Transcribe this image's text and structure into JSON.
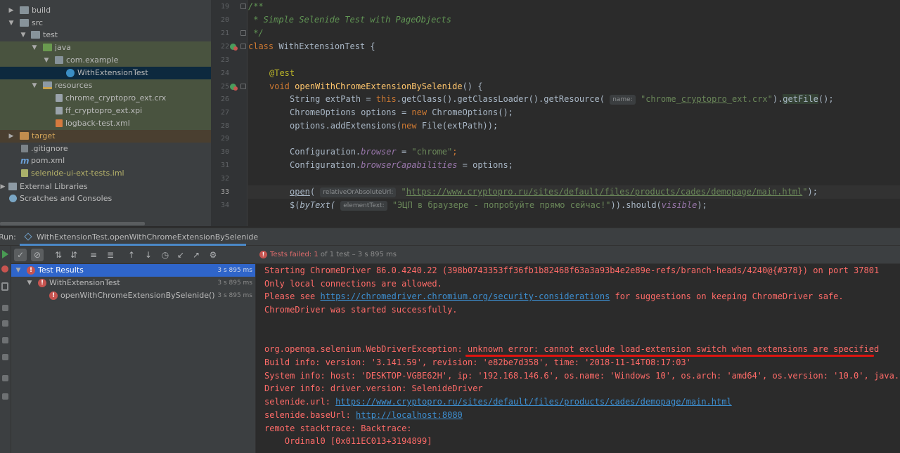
{
  "project_tree": [
    {
      "label": "build",
      "icon": "folder-icon",
      "expanded": false
    },
    {
      "label": "src",
      "icon": "folder-icon",
      "expanded": true
    },
    {
      "label": "test",
      "icon": "folder-icon",
      "expanded": true
    },
    {
      "label": "java",
      "icon": "test-source-folder-icon",
      "expanded": true
    },
    {
      "label": "com.example",
      "icon": "package-icon",
      "expanded": true
    },
    {
      "label": "WithExtensionTest",
      "icon": "class-icon"
    },
    {
      "label": "resources",
      "icon": "resources-folder-icon",
      "expanded": true
    },
    {
      "label": "chrome_cryptopro_ext.crx",
      "icon": "file-icon"
    },
    {
      "label": "ff_cryptopro_ext.xpi",
      "icon": "file-icon"
    },
    {
      "label": "logback-test.xml",
      "icon": "xml-file-icon"
    },
    {
      "label": "target",
      "icon": "excluded-folder-icon",
      "expanded": false
    },
    {
      "label": ".gitignore",
      "icon": "gitignore-file-icon"
    },
    {
      "label": "pom.xml",
      "icon": "maven-file-icon"
    },
    {
      "label": "selenide-ui-ext-tests.iml",
      "icon": "module-file-icon"
    },
    {
      "label": "External Libraries",
      "icon": "library-icon",
      "expanded": false
    },
    {
      "label": "Scratches and Consoles",
      "icon": "scratches-icon",
      "expanded": false
    }
  ],
  "editor": {
    "line_numbers": [
      "19",
      "20",
      "21",
      "22",
      "23",
      "24",
      "25",
      "26",
      "27",
      "28",
      "29",
      "30",
      "31",
      "32",
      "33",
      "34"
    ],
    "current_line": "33",
    "tokens": {
      "c1": "/**",
      "c2": " * Simple Selenide Test with PageObjects",
      "c3": " */",
      "class_kw": "class",
      "class_name": " WithExtensionTest {",
      "annotation": "@Test",
      "void_kw": "void",
      "method_name": "openWithChromeExtensionBySelenide",
      "method_rest": "() {",
      "l26_a": "String extPath = ",
      "l26_this": "this",
      "l26_b": ".getClass().getClassLoader().getResource(",
      "l26_hint": "name:",
      "l26_str_a": "\"chrome_",
      "l26_str_ul": "cryptopro",
      "l26_str_b": "_ext.crx\"",
      "l26_c": ").",
      "l26_getfile": "getFile",
      "l26_d": "();",
      "l27_a": "ChromeOptions options = ",
      "l27_new": "new",
      "l27_b": " ChromeOptions();",
      "l28_a": "options.addExtensions(",
      "l28_new": "new",
      "l28_b": " File(extPath));",
      "l30_a": "Configuration.",
      "l30_fld": "browser",
      "l30_b": " = ",
      "l30_str": "\"chrome\"",
      "l30_c": ";",
      "l31_a": "Configuration.",
      "l31_fld": "browserCapabilities",
      "l31_b": " = options;",
      "l33_open": "open",
      "l33_a": "(",
      "l33_hint": "relativeOrAbsoluteUrl:",
      "l33_q1": "\"",
      "l33_url": "https://www.cryptopro.ru/sites/default/files/products/cades/demopage/main.html",
      "l33_q2": "\"",
      "l33_b": ");",
      "l34_a": "$(",
      "l34_fn": "byText(",
      "l34_hint": "elementText:",
      "l34_str": "\"ЭЦП в браузере - попробуйте прямо сейчас!\"",
      "l34_b": ")).should(",
      "l34_fld": "visible",
      "l34_c": ");"
    }
  },
  "run_panel": {
    "title": "Run:",
    "tab_label": "WithExtensionTest.openWithChromeExtensionBySelenide",
    "status_failed": "Tests failed: 1",
    "status_rest": " of 1 test – 3 s 895 ms",
    "test_tree": [
      {
        "label": "Test Results",
        "time": "3 s 895 ms",
        "selected": true
      },
      {
        "label": "WithExtensionTest",
        "time": "3 s 895 ms",
        "selected": false
      },
      {
        "label": "openWithChromeExtensionBySelenide()",
        "time": "3 s 895 ms",
        "selected": false
      }
    ]
  },
  "console": {
    "l1": "Starting ChromeDriver 86.0.4240.22 (398b0743353ff36fb1b82468f63a3a93b4e2e89e-refs/branch-heads/4240@{#378}) on port 37801",
    "l2": "Only local connections are allowed.",
    "l3_a": "Please see ",
    "l3_link": "https://chromedriver.chromium.org/security-considerations",
    "l3_b": " for suggestions on keeping ChromeDriver safe.",
    "l4": "ChromeDriver was started successfully.",
    "l5": "org.openqa.selenium.WebDriverException: unknown error: cannot exclude load-extension switch when extensions are specified",
    "l6": "Build info: version: '3.141.59', revision: 'e82be7d358', time: '2018-11-14T08:17:03'",
    "l7": "System info: host: 'DESKTOP-VGBE62H', ip: '192.168.146.6', os.name: 'Windows 10', os.arch: 'amd64', os.version: '10.0', java.ve",
    "l8": "Driver info: driver.version: SelenideDriver",
    "l9_a": "selenide.url: ",
    "l9_link": "https://www.cryptopro.ru/sites/default/files/products/cades/demopage/main.html",
    "l10_a": "selenide.baseUrl: ",
    "l10_link": "http://localhost:8080",
    "l11": "remote stacktrace: Backtrace:",
    "l12": "    Ordinal0 [0x011EC013+3194899]"
  },
  "colors": {
    "error": "#ff6b68",
    "link": "#3d8fd1",
    "selection": "#2f65ca",
    "underline_mark": "#e0140f"
  }
}
